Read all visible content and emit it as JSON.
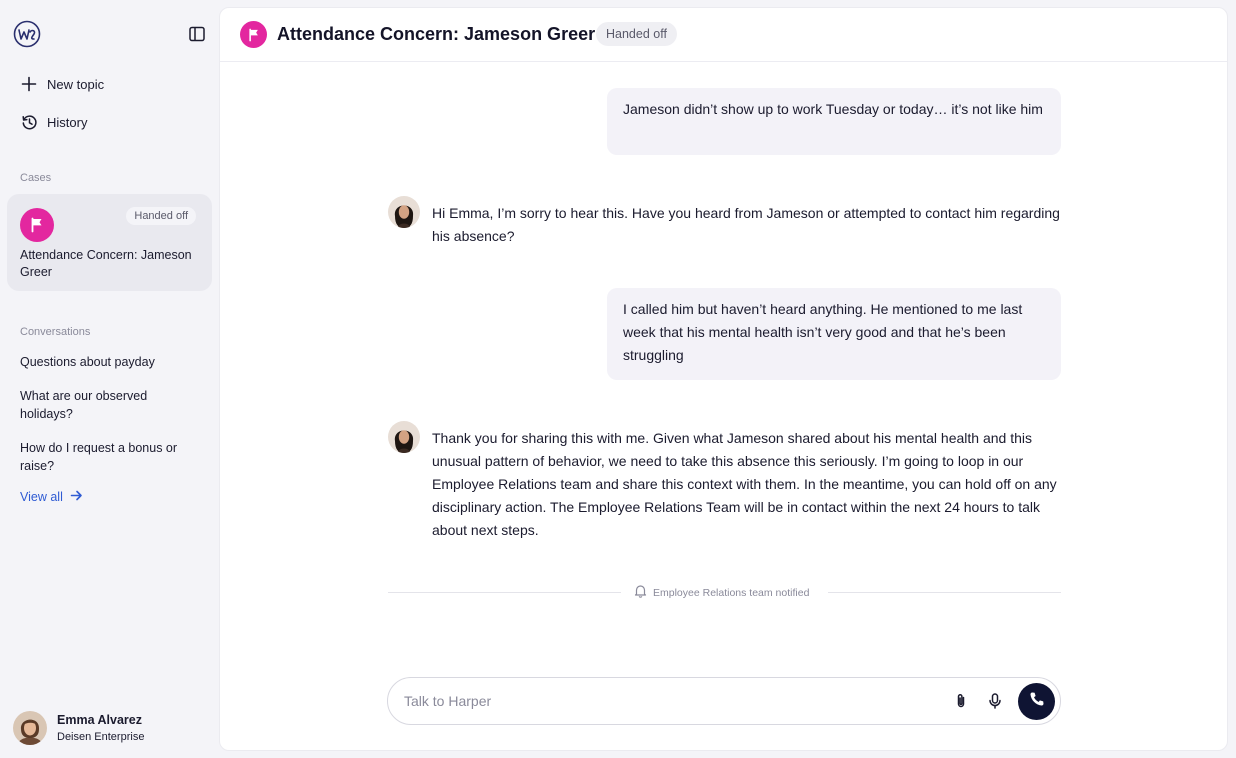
{
  "sidebar": {
    "new_topic": "New topic",
    "history": "History",
    "cases_label": "Cases",
    "case": {
      "badge": "Handed off",
      "title": "Attendance Concern: Jameson Greer"
    },
    "conversations_label": "Conversations",
    "conversations": [
      "Questions about payday",
      "What are our observed holidays?",
      "How do I request a bonus or raise?"
    ],
    "view_all": "View all",
    "user": {
      "name": "Emma Alvarez",
      "org": "Deisen Enterprise"
    }
  },
  "header": {
    "title": "Attendance Concern: Jameson Greer",
    "status": "Handed off"
  },
  "messages": [
    {
      "role": "user",
      "text": "Jameson didn’t show up to work Tuesday or today… it’s not like him"
    },
    {
      "role": "assistant",
      "text": "Hi Emma, I’m sorry to hear this. Have you heard from Jameson or attempted to contact him regarding his absence?"
    },
    {
      "role": "user",
      "text": "I called him but haven’t heard anything. He mentioned to me last week that his mental health isn’t very good and that he’s been struggling"
    },
    {
      "role": "assistant",
      "text": "Thank you for sharing this with me. Given what Jameson shared about his mental health and this unusual pattern of behavior, we need to take this absence this seriously. I’m going to loop in our Employee Relations team and share this context with them. In the meantime, you can hold off on any disciplinary action. The Employee Relations Team will be in contact within the next 24 hours to talk about next steps."
    }
  ],
  "notification": "Employee Relations team notified",
  "composer": {
    "placeholder": "Talk to Harper"
  },
  "colors": {
    "flag": "#e3279f",
    "link": "#2f5bd3",
    "call_button": "#0f1433",
    "bubble": "#f3f2f8"
  }
}
